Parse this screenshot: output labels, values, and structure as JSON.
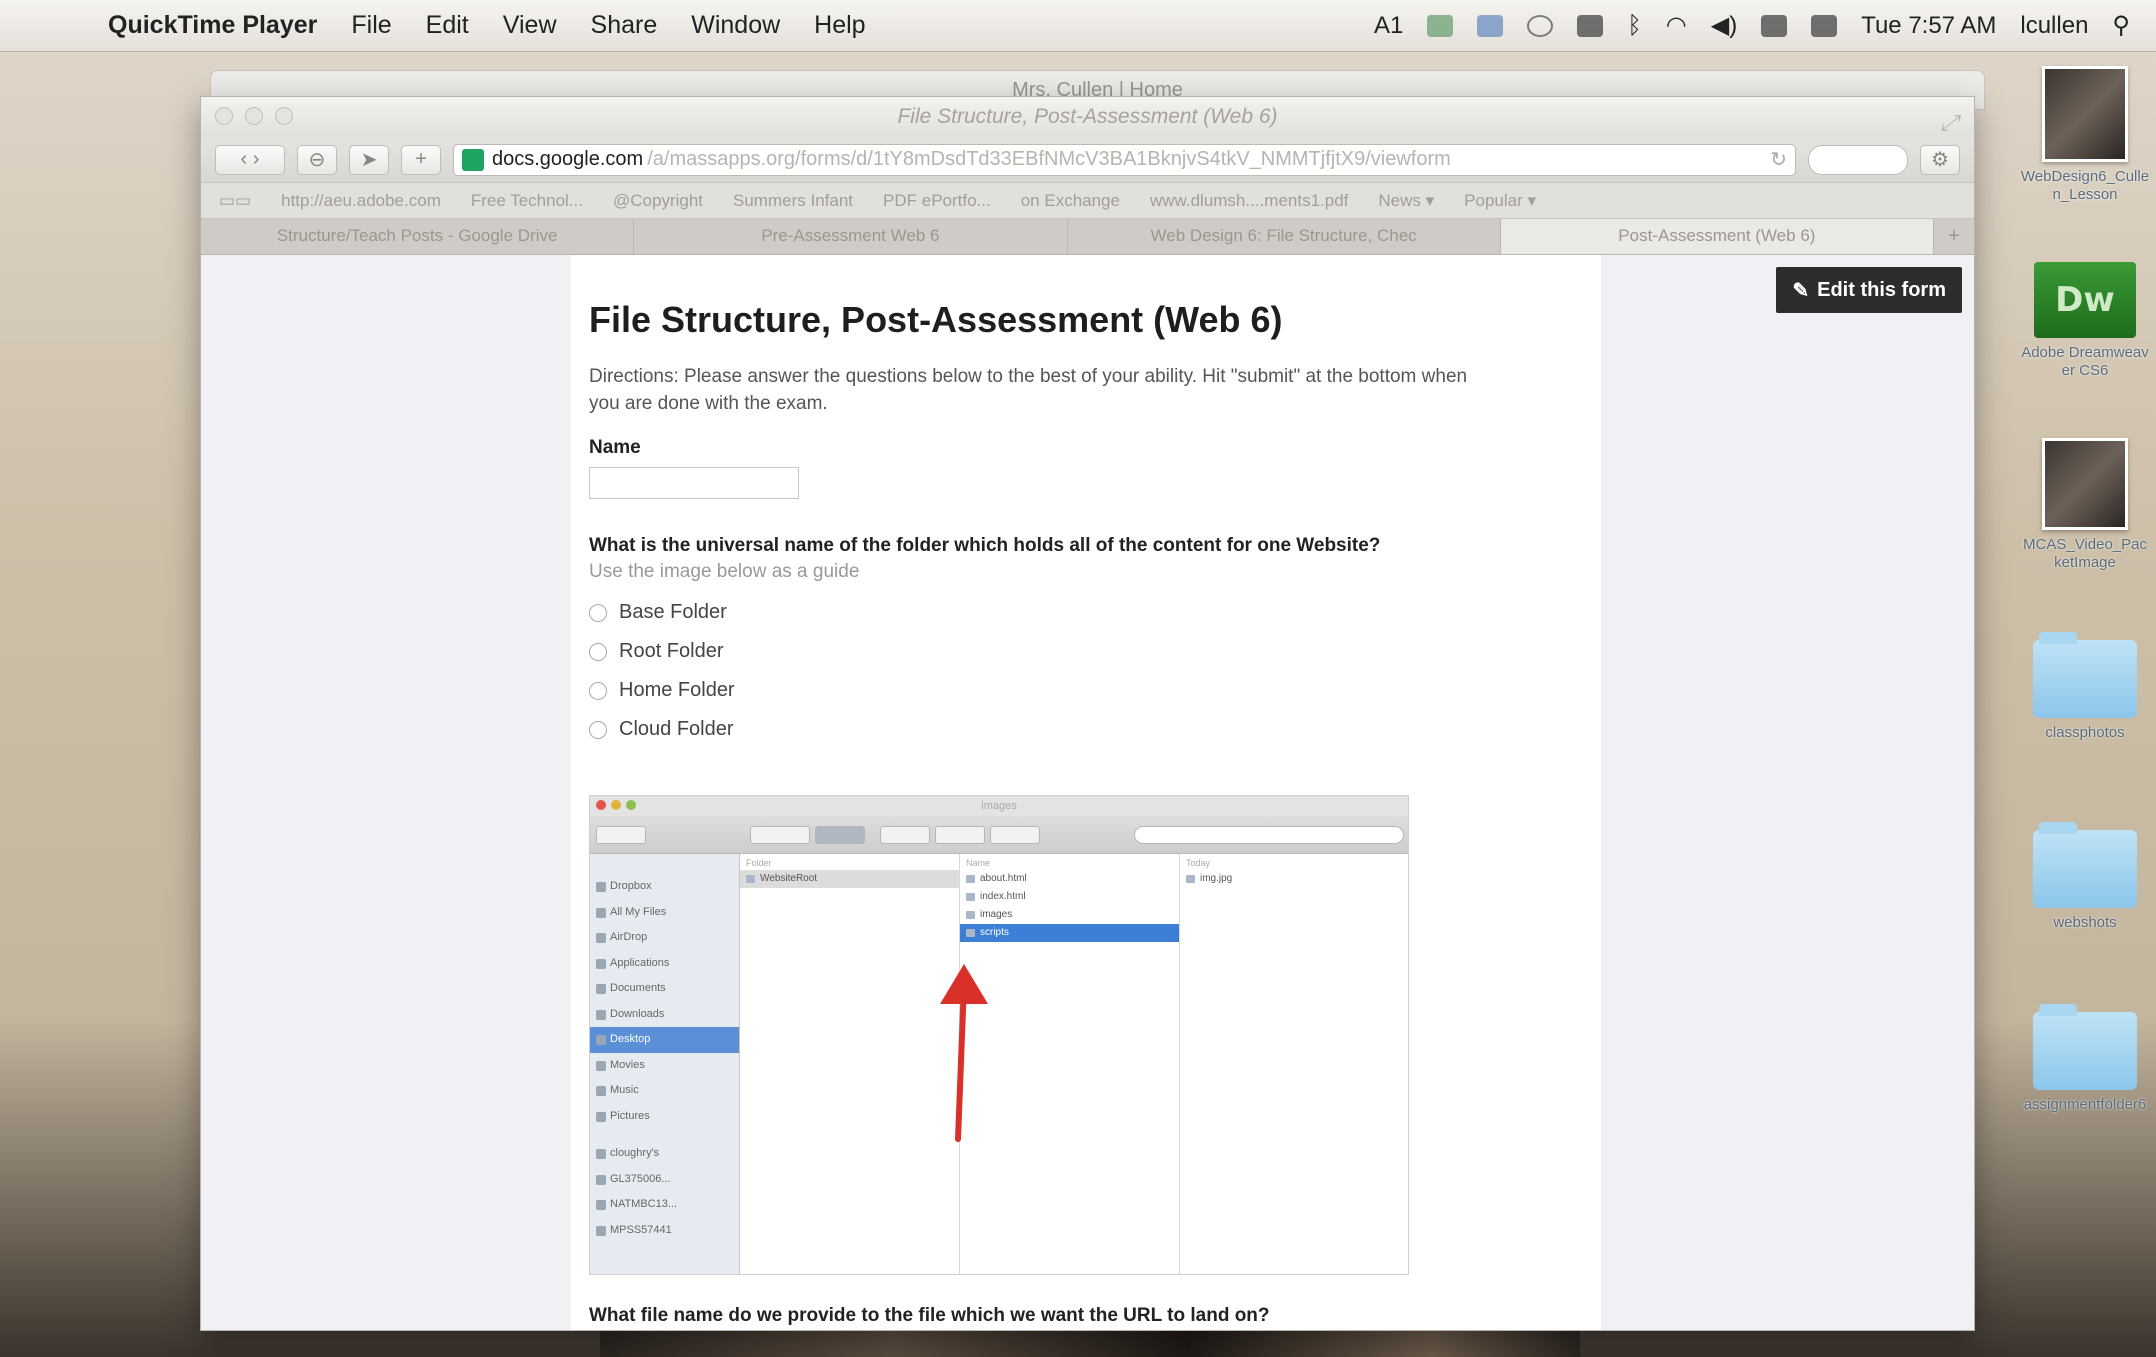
{
  "menubar": {
    "app": "QuickTime Player",
    "items": [
      "File",
      "Edit",
      "View",
      "Share",
      "Window",
      "Help"
    ],
    "status_text": "Tue 7:57 AM",
    "user": "lcullen",
    "battery_label": "A1"
  },
  "back_window": {
    "title": "Mrs. Cullen | Home"
  },
  "browser": {
    "title": "File Structure, Post-Assessment (Web 6)",
    "address_domain": "docs.google.com",
    "address_path": "/a/massapps.org/forms/d/1tY8mDsdTd33EBfNMcV3BA1BknjvS4tkV_NMMTjfjtX9/viewform",
    "bookmarks": [
      "http://aeu.adobe.com",
      "Free Technol...",
      "@Copyright",
      "Summers Infant",
      "PDF ePortfo...",
      "on Exchange",
      "www.dlumsh....ments1.pdf",
      "News ▾",
      "Popular ▾"
    ],
    "tabs": [
      "Structure/Teach Posts - Google Drive",
      "Pre-Assessment Web 6",
      "Web Design 6: File Structure, Chec",
      "Post-Assessment (Web 6)"
    ],
    "tab_add": "+"
  },
  "form": {
    "edit_button": "Edit this form",
    "title": "File Structure, Post-Assessment (Web 6)",
    "description": "Directions: Please answer the questions below to the best of your ability. Hit \"submit\" at the bottom when you are done with the exam.",
    "name_label": "Name",
    "question1": "What is the universal name of the folder which holds all of the content for one Website?",
    "question1_help": "Use the image below as a guide",
    "options": [
      "Base Folder",
      "Root Folder",
      "Home Folder",
      "Cloud Folder"
    ],
    "question2": "What file name do we provide to the file which we want the URL to land on?"
  },
  "finder": {
    "title": "images",
    "sidebar_favorites": [
      "Dropbox",
      "All My Files",
      "AirDrop",
      "Applications",
      "Documents",
      "Downloads",
      "Desktop",
      "Movies",
      "Music",
      "Pictures"
    ],
    "sidebar_devices": [
      "cloughry's",
      "GL375006...",
      "NATMBC13...",
      "MPSS57441"
    ],
    "col1_header": "Folder",
    "col1_items": [
      "WebsiteRoot"
    ],
    "col2_header": "Name",
    "col2_items": [
      "about.html",
      "index.html",
      "images",
      "scripts"
    ],
    "col3_header": "Today",
    "col3_items": [
      "img.jpg"
    ]
  },
  "desktop_icons": [
    {
      "label": "WebDesign6_Cullen_Lesson"
    },
    {
      "label": "Adobe Dreamweaver CS6"
    },
    {
      "label": "MCAS_Video_PacketImage"
    },
    {
      "label": "classphotos"
    },
    {
      "label": "webshots"
    },
    {
      "label": "assignmentfolder6"
    }
  ]
}
